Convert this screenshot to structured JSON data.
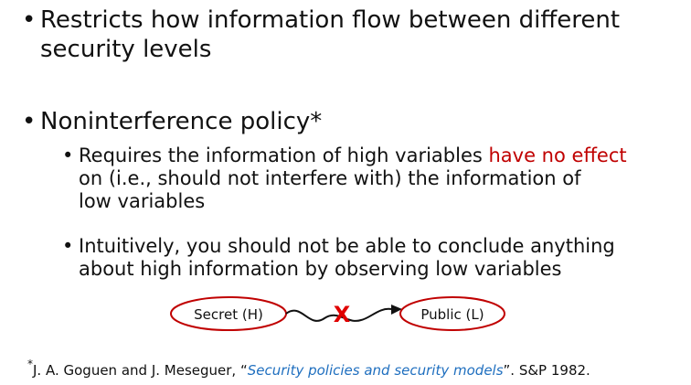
{
  "slide": {
    "bullet1": {
      "line1": "Restricts how information flow between different",
      "line2": "security levels"
    },
    "bullet2": {
      "title": "Noninterference policy*",
      "sub1": {
        "line1_pre": "Requires the information of high variables ",
        "line1_highlight": "have no effect",
        "line2": "on (i.e., should not interfere with) the information of",
        "line3": "low variables"
      },
      "sub2": {
        "line1": "Intuitively, you should not be able to conclude anything",
        "line2": "about high information by observing low variables"
      }
    }
  },
  "diagram": {
    "left_label": "Secret (H)",
    "right_label": "Public (L)",
    "blocked_mark": "X"
  },
  "footnote": {
    "marker": "*",
    "authors": "J. A. Goguen and J. Meseguer, “",
    "title": "Security policies and security models",
    "suffix": "”. S&P 1982."
  },
  "colors": {
    "highlight_red": "#c00000",
    "link_blue": "#1f6fbf",
    "text": "#111111"
  }
}
